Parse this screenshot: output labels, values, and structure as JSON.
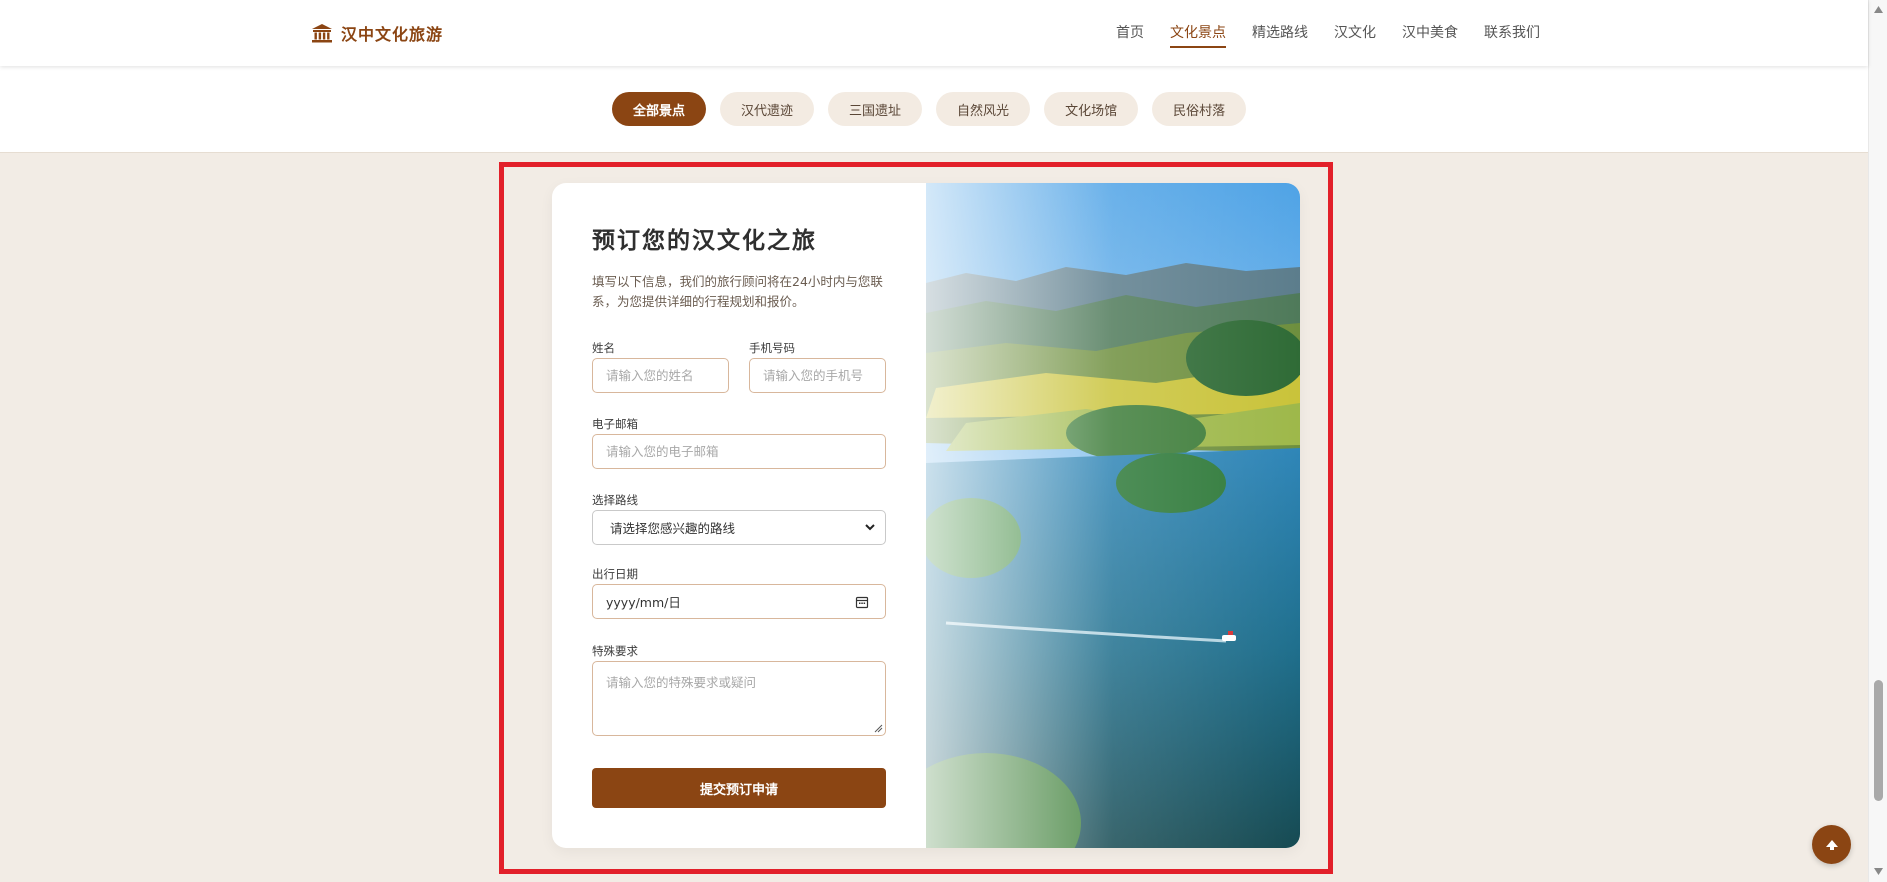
{
  "header": {
    "brand": "汉中文化旅游",
    "nav": [
      {
        "label": "首页",
        "active": false
      },
      {
        "label": "文化景点",
        "active": true
      },
      {
        "label": "精选路线",
        "active": false
      },
      {
        "label": "汉文化",
        "active": false
      },
      {
        "label": "汉中美食",
        "active": false
      },
      {
        "label": "联系我们",
        "active": false
      }
    ]
  },
  "filters": [
    {
      "label": "全部景点",
      "active": true
    },
    {
      "label": "汉代遗迹",
      "active": false
    },
    {
      "label": "三国遗址",
      "active": false
    },
    {
      "label": "自然风光",
      "active": false
    },
    {
      "label": "文化场馆",
      "active": false
    },
    {
      "label": "民俗村落",
      "active": false
    }
  ],
  "booking": {
    "title": "预订您的汉文化之旅",
    "description": "填写以下信息，我们的旅行顾问将在24小时内与您联系，为您提供详细的行程规划和报价。",
    "name_label": "姓名",
    "name_placeholder": "请输入您的姓名",
    "phone_label": "手机号码",
    "phone_placeholder": "请输入您的手机号",
    "email_label": "电子邮箱",
    "email_placeholder": "请输入您的电子邮箱",
    "route_label": "选择路线",
    "route_value": "请选择您感兴趣的路线",
    "date_label": "出行日期",
    "date_value": "yyyy/mm/日",
    "notes_label": "特殊要求",
    "notes_placeholder": "请输入您的特殊要求或疑问",
    "submit_label": "提交预订申请"
  },
  "colors": {
    "accent": "#8b4513",
    "chip_bg": "#f3ebe2",
    "page_bg": "#f2ece5",
    "highlight": "#e2202a"
  },
  "icons": {
    "brand": "temple-icon",
    "select": "chevron-down-icon",
    "date": "calendar-icon",
    "to_top": "arrow-up-icon"
  }
}
